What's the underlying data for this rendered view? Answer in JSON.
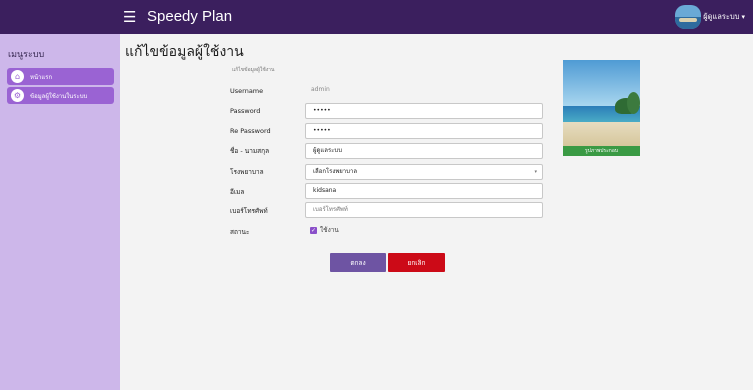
{
  "header": {
    "app_title": "Speedy Plan",
    "menu_icon": "hamburger-icon",
    "user_name": "ผู้ดูแลระบบ",
    "user_caret": "▾"
  },
  "sidebar": {
    "heading": "เมนูระบบ",
    "items": [
      {
        "label": "หน้าแรก",
        "icon": "home-icon"
      },
      {
        "label": "ข้อมูลผู้ใช้งานในระบบ",
        "icon": "cogs-icon"
      }
    ]
  },
  "page": {
    "title": "แก้ไขข้อมูลผู้ใช้งาน",
    "subcaption": "แก้ไขข้อมูลผู้ใช้งาน"
  },
  "form": {
    "username": {
      "label": "Username",
      "value": "admin"
    },
    "password": {
      "label": "Password",
      "value": "•••••"
    },
    "re_password": {
      "label": "Re Password",
      "value": "•••••"
    },
    "fullname": {
      "label": "ชื่อ - นามสกุล",
      "value": "ผู้ดูแลระบบ"
    },
    "hospital": {
      "label": "โรงพยาบาล",
      "value": "เลือกโรงพยาบาล"
    },
    "email": {
      "label": "อีเมล",
      "value": "kidsana"
    },
    "phone": {
      "label": "เบอร์โทรศัพท์",
      "value": "",
      "placeholder": "เบอร์โทรศัพท์"
    },
    "status": {
      "label": "สถานะ",
      "checkbox_label": "ใช้งาน",
      "checked": true
    }
  },
  "buttons": {
    "submit": "ตกลง",
    "cancel": "ยกเลิก"
  },
  "photo": {
    "caption": "รูปภาพประกอบ"
  },
  "colors": {
    "topbar": "#3b1f5e",
    "sidebar": "#cdb7ea",
    "sidebar_item": "#9a63d3",
    "submit": "#6e54a3",
    "cancel": "#cc0a17",
    "photo_caption": "#3a9a44"
  }
}
